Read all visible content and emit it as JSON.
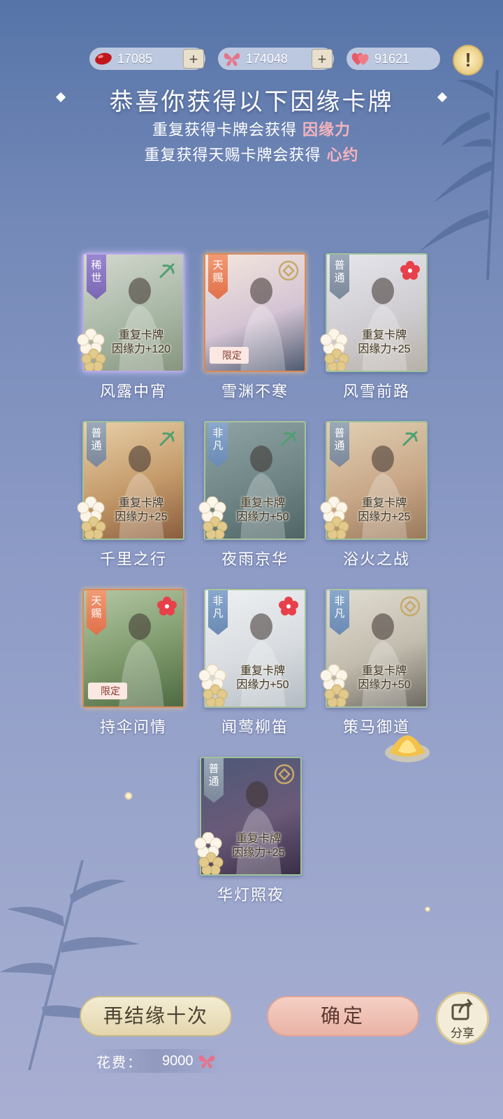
{
  "currencies": [
    {
      "icon": "red-bean-icon",
      "value": "17085",
      "has_plus": true
    },
    {
      "icon": "butterfly-icon",
      "value": "174048",
      "has_plus": true
    },
    {
      "icon": "heart-icon",
      "value": "91621",
      "has_plus": false
    }
  ],
  "plus_label": "+",
  "alert_label": "!",
  "title": "恭喜你获得以下因缘卡牌",
  "subtitle_1": {
    "text": "重复获得卡牌会获得",
    "highlight": "因缘力"
  },
  "subtitle_2": {
    "text": "重复获得天赐卡牌会获得",
    "highlight": "心约"
  },
  "cards": [
    {
      "name": "风露中宵",
      "rank": "稀世",
      "rank_type": "rare",
      "dup_line1": "重复卡牌",
      "dup_line2": "因缘力+120",
      "limited": "",
      "emblem": "fan-emblem"
    },
    {
      "name": "雪渊不寒",
      "rank": "天赐",
      "rank_type": "gift",
      "dup_line1": "",
      "dup_line2": "",
      "limited": "限定",
      "emblem": "coin-emblem"
    },
    {
      "name": "风雪前路",
      "rank": "普通",
      "rank_type": "common",
      "dup_line1": "重复卡牌",
      "dup_line2": "因缘力+25",
      "limited": "",
      "emblem": "flower-emblem"
    },
    {
      "name": "千里之行",
      "rank": "普通",
      "rank_type": "common",
      "dup_line1": "重复卡牌",
      "dup_line2": "因缘力+25",
      "limited": "",
      "emblem": "fan-emblem"
    },
    {
      "name": "夜雨京华",
      "rank": "非凡",
      "rank_type": "elite",
      "dup_line1": "重复卡牌",
      "dup_line2": "因缘力+50",
      "limited": "",
      "emblem": "fan-emblem"
    },
    {
      "name": "浴火之战",
      "rank": "普通",
      "rank_type": "common",
      "dup_line1": "重复卡牌",
      "dup_line2": "因缘力+25",
      "limited": "",
      "emblem": "fan-emblem"
    },
    {
      "name": "持伞问情",
      "rank": "天赐",
      "rank_type": "gift",
      "dup_line1": "",
      "dup_line2": "",
      "limited": "限定",
      "emblem": "flower-emblem"
    },
    {
      "name": "闻莺柳笛",
      "rank": "非凡",
      "rank_type": "elite",
      "dup_line1": "重复卡牌",
      "dup_line2": "因缘力+50",
      "limited": "",
      "emblem": "flower-emblem"
    },
    {
      "name": "策马御道",
      "rank": "非凡",
      "rank_type": "elite",
      "dup_line1": "重复卡牌",
      "dup_line2": "因缘力+50",
      "limited": "",
      "emblem": "coin-emblem"
    },
    {
      "name": "华灯照夜",
      "rank": "普通",
      "rank_type": "common",
      "dup_line1": "重复卡牌",
      "dup_line2": "因缘力+25",
      "limited": "",
      "emblem": "coin-emblem"
    }
  ],
  "buttons": {
    "again": "再结缘十次",
    "confirm": "确定",
    "share": "分享"
  },
  "cost": {
    "label": "花费：",
    "value": "9000",
    "icon": "butterfly-icon"
  },
  "colors": {
    "highlight": "#f4b3bd",
    "rare": "#8a76c4",
    "gift": "#e8805a",
    "common": "#8b98aa",
    "elite": "#7a9ac0"
  }
}
